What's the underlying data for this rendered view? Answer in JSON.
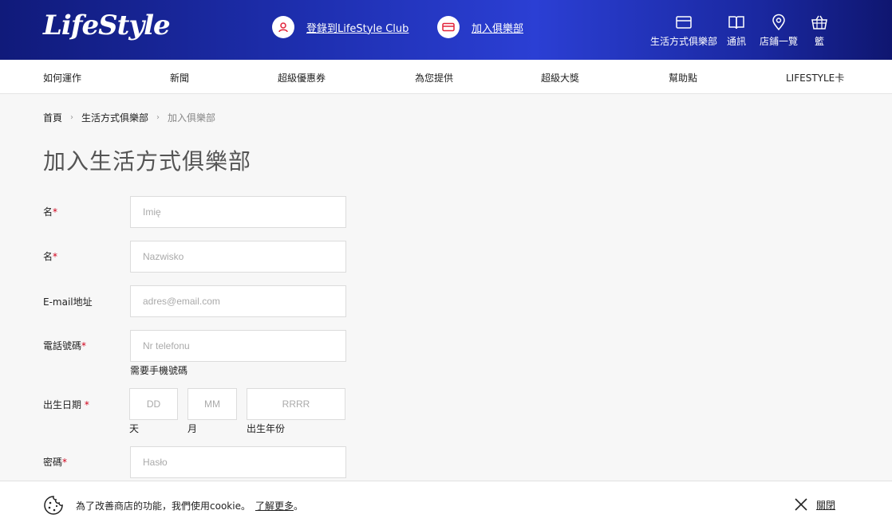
{
  "header": {
    "logo": "LifeStyle",
    "login_label": "登錄到LifeStyle Club",
    "join_label": "加入俱樂部",
    "icons": [
      {
        "name": "card-icon",
        "label": "生活方式俱樂部"
      },
      {
        "name": "book-icon",
        "label": "通訊"
      },
      {
        "name": "location-pin-icon",
        "label": "店鋪一覽"
      },
      {
        "name": "basket-icon",
        "label": "籃"
      }
    ]
  },
  "nav": {
    "items": [
      "如何運作",
      "新聞",
      "超級優惠券",
      "為您提供",
      "超級大獎",
      "幫助點",
      "LIFESTYLE卡"
    ]
  },
  "breadcrumb": {
    "items": [
      "首頁",
      "生活方式俱樂部",
      "加入俱樂部"
    ]
  },
  "page_title": "加入生活方式俱樂部",
  "form": {
    "first_name": {
      "label": "名",
      "required_mark": "*",
      "placeholder": "Imię"
    },
    "last_name": {
      "label": "名",
      "required_mark": "*",
      "placeholder": "Nazwisko"
    },
    "email": {
      "label": "E-mail地址",
      "placeholder": "adres@email.com"
    },
    "phone": {
      "label": "電話號碼",
      "required_mark": "*",
      "placeholder": "Nr telefonu",
      "hint": "需要手機號碼"
    },
    "birthdate": {
      "label": "出生日期",
      "required_mark": "*",
      "day_placeholder": "DD",
      "month_placeholder": "MM",
      "year_placeholder": "RRRR",
      "day_hint": "天",
      "month_hint": "月",
      "year_hint": "出生年份"
    },
    "password": {
      "label": "密碼",
      "required_mark": "*",
      "placeholder": "Hasło"
    }
  },
  "cookie_bar": {
    "text": "為了改善商店的功能，我們使用cookie。",
    "link": "了解更多",
    "link_suffix": "。",
    "close_label": "關閉"
  },
  "colors": {
    "header_start": "#101a7a",
    "header_mid": "#2b3fd4",
    "accent_red": "#d0021b",
    "page_bg": "#f7f7f7"
  }
}
